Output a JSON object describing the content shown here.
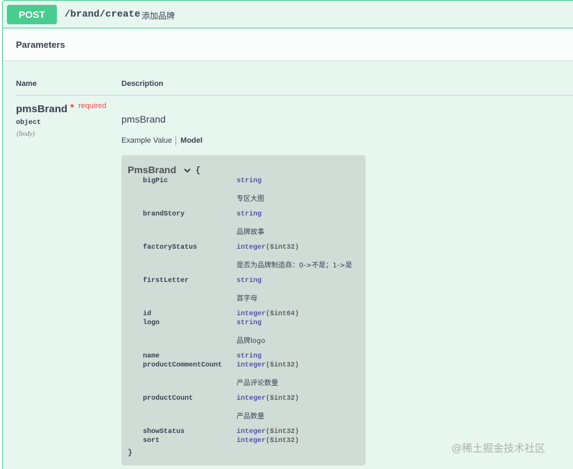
{
  "operation": {
    "method": "POST",
    "path": "/brand/create",
    "summary": "添加品牌",
    "accent_color": "#49cc90"
  },
  "parameters": {
    "title": "Parameters",
    "col_name": "Name",
    "col_description": "Description",
    "param": {
      "name": "pmsBrand",
      "required_star": "*",
      "required_label": "required",
      "type": "object",
      "in": "(body)",
      "description": "pmsBrand"
    },
    "tabs": {
      "example": "Example Value",
      "model": "Model"
    }
  },
  "model": {
    "title": "PmsBrand",
    "open_brace": "{",
    "close_brace": "}",
    "chevron_icon": "chevron-down-icon",
    "properties": [
      {
        "name": "bigPic",
        "type": "string",
        "format": "",
        "description": "专区大图"
      },
      {
        "name": "brandStory",
        "type": "string",
        "format": "",
        "description": "品牌故事"
      },
      {
        "name": "factoryStatus",
        "type": "integer",
        "format": "($int32)",
        "description": "是否为品牌制造商：0->不是；1->是"
      },
      {
        "name": "firstLetter",
        "type": "string",
        "format": "",
        "description": "首字母"
      },
      {
        "name": "id",
        "type": "integer",
        "format": "($int64)",
        "description": ""
      },
      {
        "name": "logo",
        "type": "string",
        "format": "",
        "description": "品牌logo"
      },
      {
        "name": "name",
        "type": "string",
        "format": "",
        "description": ""
      },
      {
        "name": "productCommentCount",
        "type": "integer",
        "format": "($int32)",
        "description": "产品评论数量"
      },
      {
        "name": "productCount",
        "type": "integer",
        "format": "($int32)",
        "description": "产品数量"
      },
      {
        "name": "showStatus",
        "type": "integer",
        "format": "($int32)",
        "description": ""
      },
      {
        "name": "sort",
        "type": "integer",
        "format": "($int32)",
        "description": ""
      }
    ]
  },
  "watermark": "@稀土掘金技术社区"
}
